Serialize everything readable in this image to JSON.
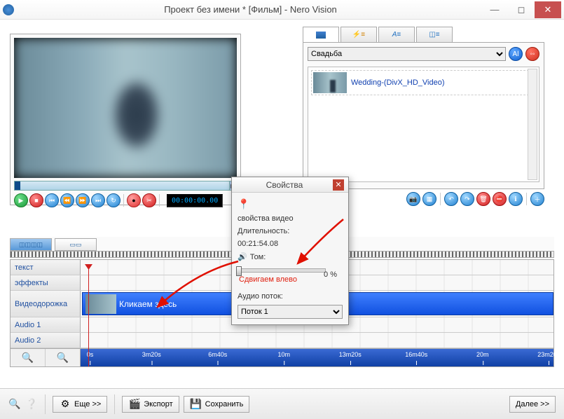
{
  "title": "Проект без имени * [Фильм] - Nero Vision",
  "timecode": "00:00:00.00",
  "media_search": {
    "selected": "Свадьба",
    "options": [
      "Свадьба"
    ]
  },
  "media_item": "Wedding-(DivX_HD_Video)",
  "timeline": {
    "tracks": {
      "text": "текст",
      "effects": "эффекты",
      "video": "Видеодорожка",
      "audio1": "Audio 1",
      "audio2": "Audio 2"
    },
    "clip_label": "Кликаем здесь",
    "marks": [
      "0s",
      "3m20s",
      "6m40s",
      "10m",
      "13m20s",
      "16m40s",
      "20m",
      "23m20s"
    ]
  },
  "properties": {
    "title": "Свойства",
    "section": "свойства видео",
    "duration_label": "Длительность:",
    "duration_value": "00:21:54.08",
    "volume_label": "Том:",
    "volume_pct": "0 %",
    "slide_hint": "Сдвигаем влево",
    "stream_label": "Аудио поток:",
    "stream_selected": "Поток 1"
  },
  "buttons": {
    "more": "Еще >>",
    "export": "Экспорт",
    "save": "Сохранить",
    "next": "Далее >>"
  },
  "icons": {
    "play": "▶",
    "stop": "■",
    "prev": "⏮",
    "back": "⏪",
    "fwd": "⏩",
    "next": "⏭",
    "cut": "✂",
    "snap": "📷",
    "loop": "↻",
    "undo": "↶",
    "redo": "↷",
    "del": "🗑",
    "warn": "⛔",
    "info": "ℹ",
    "plus": "＋",
    "speaker": "🔊",
    "pin": "📍",
    "film": "▭▭",
    "fx": "⚡≡",
    "txt": "A≡",
    "trans": "◫≡",
    "search": "🔍",
    "help": "❔",
    "gear": "⚙",
    "save": "💾",
    "film2": "🎬"
  }
}
